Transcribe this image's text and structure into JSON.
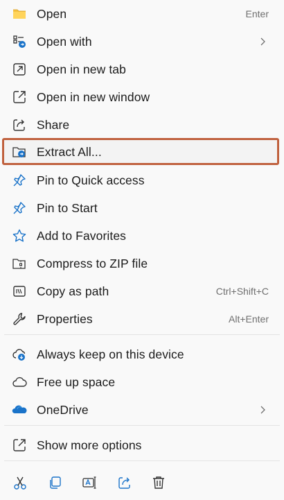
{
  "menu": {
    "items": [
      {
        "label": "Open",
        "shortcut": "Enter",
        "icon": "folder-icon"
      },
      {
        "label": "Open with",
        "shortcut": "",
        "icon": "open-with-icon",
        "submenu": true
      },
      {
        "label": "Open in new tab",
        "shortcut": "",
        "icon": "new-tab-icon"
      },
      {
        "label": "Open in new window",
        "shortcut": "",
        "icon": "new-window-icon"
      },
      {
        "label": "Share",
        "shortcut": "",
        "icon": "share-icon"
      },
      {
        "label": "Extract All...",
        "shortcut": "",
        "icon": "extract-icon",
        "highlighted": true
      },
      {
        "label": "Pin to Quick access",
        "shortcut": "",
        "icon": "pin-icon"
      },
      {
        "label": "Pin to Start",
        "shortcut": "",
        "icon": "pin-icon"
      },
      {
        "label": "Add to Favorites",
        "shortcut": "",
        "icon": "star-icon"
      },
      {
        "label": "Compress to ZIP file",
        "shortcut": "",
        "icon": "zip-icon"
      },
      {
        "label": "Copy as path",
        "shortcut": "Ctrl+Shift+C",
        "icon": "copy-path-icon"
      },
      {
        "label": "Properties",
        "shortcut": "Alt+Enter",
        "icon": "wrench-icon"
      },
      {
        "label": "Always keep on this device",
        "shortcut": "",
        "icon": "cloud-download-icon"
      },
      {
        "label": "Free up space",
        "shortcut": "",
        "icon": "cloud-icon"
      },
      {
        "label": "OneDrive",
        "shortcut": "",
        "icon": "onedrive-icon",
        "submenu": true
      },
      {
        "label": "Show more options",
        "shortcut": "",
        "icon": "show-more-icon"
      }
    ]
  },
  "toolbar": {
    "buttons": [
      {
        "icon": "cut-icon"
      },
      {
        "icon": "copy-icon"
      },
      {
        "icon": "rename-icon"
      },
      {
        "icon": "share-icon"
      },
      {
        "icon": "delete-icon"
      }
    ]
  },
  "colors": {
    "accent": "#1a73c9",
    "highlight_border": "#c0613e",
    "folder_yellow": "#f5c242"
  }
}
